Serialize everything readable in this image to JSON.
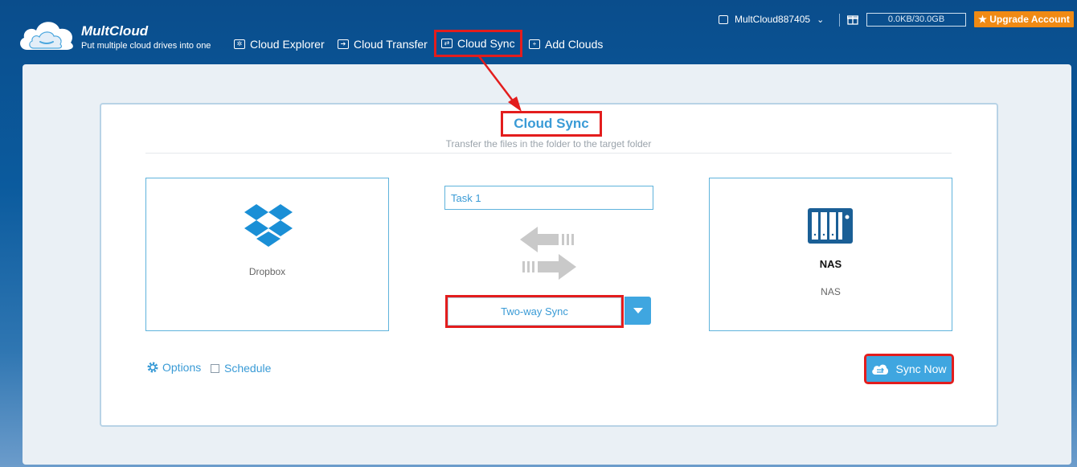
{
  "header": {
    "brand_name": "MultCloud",
    "brand_tagline": "Put multiple cloud drives into one",
    "nav": [
      {
        "label": "Cloud Explorer",
        "icon": "cloud-explorer-icon"
      },
      {
        "label": "Cloud Transfer",
        "icon": "cloud-transfer-icon"
      },
      {
        "label": "Cloud Sync",
        "icon": "cloud-sync-icon",
        "highlighted": true
      },
      {
        "label": "Add Clouds",
        "icon": "add-clouds-icon"
      }
    ],
    "username": "MultCloud887405",
    "storage": "0.0KB/30.0GB",
    "upgrade_label": "★ Upgrade Account"
  },
  "sync_card": {
    "title": "Cloud Sync",
    "subtitle": "Transfer the files in the folder to the target folder",
    "source": {
      "label": "Dropbox",
      "icon": "dropbox-icon"
    },
    "target": {
      "title": "NAS",
      "label": "NAS",
      "icon": "nas-icon"
    },
    "task_name": "Task 1",
    "sync_mode": "Two-way Sync",
    "options_label": "Options",
    "schedule_label": "Schedule",
    "schedule_checked": false,
    "sync_now_label": "Sync Now"
  },
  "colors": {
    "accent": "#3fa6e0",
    "highlight": "#e31d1d",
    "upgrade": "#f08a14"
  }
}
